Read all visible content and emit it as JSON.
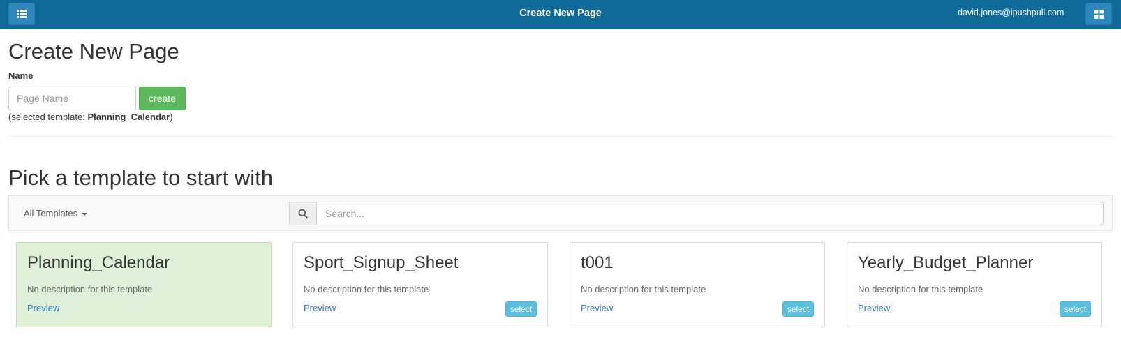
{
  "header": {
    "title": "Create New Page",
    "user": "david.jones@ipushpull.com",
    "menu_icon": "list-icon",
    "apps_icon": "grid-icon"
  },
  "form": {
    "heading": "Create New Page",
    "name_label": "Name",
    "name_placeholder": "Page Name",
    "name_value": "",
    "create_label": "create",
    "selected_prefix": "(selected template: ",
    "selected_template": "Planning_Calendar",
    "selected_suffix": ")"
  },
  "templates": {
    "heading": "Pick a template to start with",
    "filter_label": "All Templates",
    "search_placeholder": "Search...",
    "search_icon": "search-icon",
    "items": [
      {
        "name": "Planning_Calendar",
        "description": "No description for this template",
        "preview": "Preview",
        "select": "",
        "selected": true
      },
      {
        "name": "Sport_Signup_Sheet",
        "description": "No description for this template",
        "preview": "Preview",
        "select": "select",
        "selected": false
      },
      {
        "name": "t001",
        "description": "No description for this template",
        "preview": "Preview",
        "select": "select",
        "selected": false
      },
      {
        "name": "Yearly_Budget_Planner",
        "description": "No description for this template",
        "preview": "Preview",
        "select": "select",
        "selected": false
      }
    ]
  },
  "colors": {
    "header_bg": "#106a99",
    "create_button": "#5cb85c",
    "select_button": "#5bc0de",
    "selected_card_bg": "#dff0d8",
    "link": "#337ab7"
  }
}
